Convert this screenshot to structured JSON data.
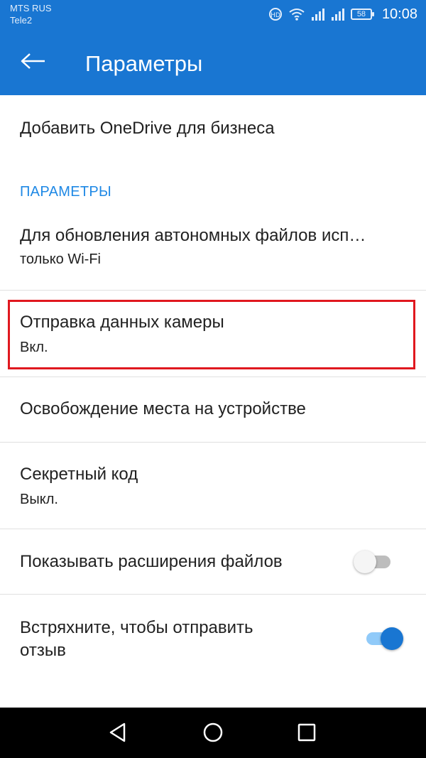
{
  "status_bar": {
    "carrier_1": "MTS RUS",
    "carrier_2": "Tele2",
    "battery": "58",
    "time": "10:08"
  },
  "app_bar": {
    "title": "Параметры"
  },
  "items": {
    "add_onedrive": "Добавить OneDrive для бизнеса",
    "section_header": "ПАРАМЕТРЫ",
    "offline_update": {
      "primary": "Для обновления автономных файлов исп…",
      "secondary": "только Wi-Fi"
    },
    "camera_upload": {
      "primary": "Отправка данных камеры",
      "secondary": "Вкл."
    },
    "free_space": "Освобождение места на устройстве",
    "passcode": {
      "primary": "Секретный код",
      "secondary": "Выкл."
    },
    "show_extensions": {
      "primary": "Показывать расширения файлов",
      "toggle": false
    },
    "shake_feedback": {
      "primary_line1": "Встряхните, чтобы отправить",
      "primary_line2": "отзыв",
      "toggle": true
    }
  },
  "colors": {
    "accent": "#1976d2",
    "section_header": "#1e88e5",
    "highlight": "#e0181f"
  }
}
